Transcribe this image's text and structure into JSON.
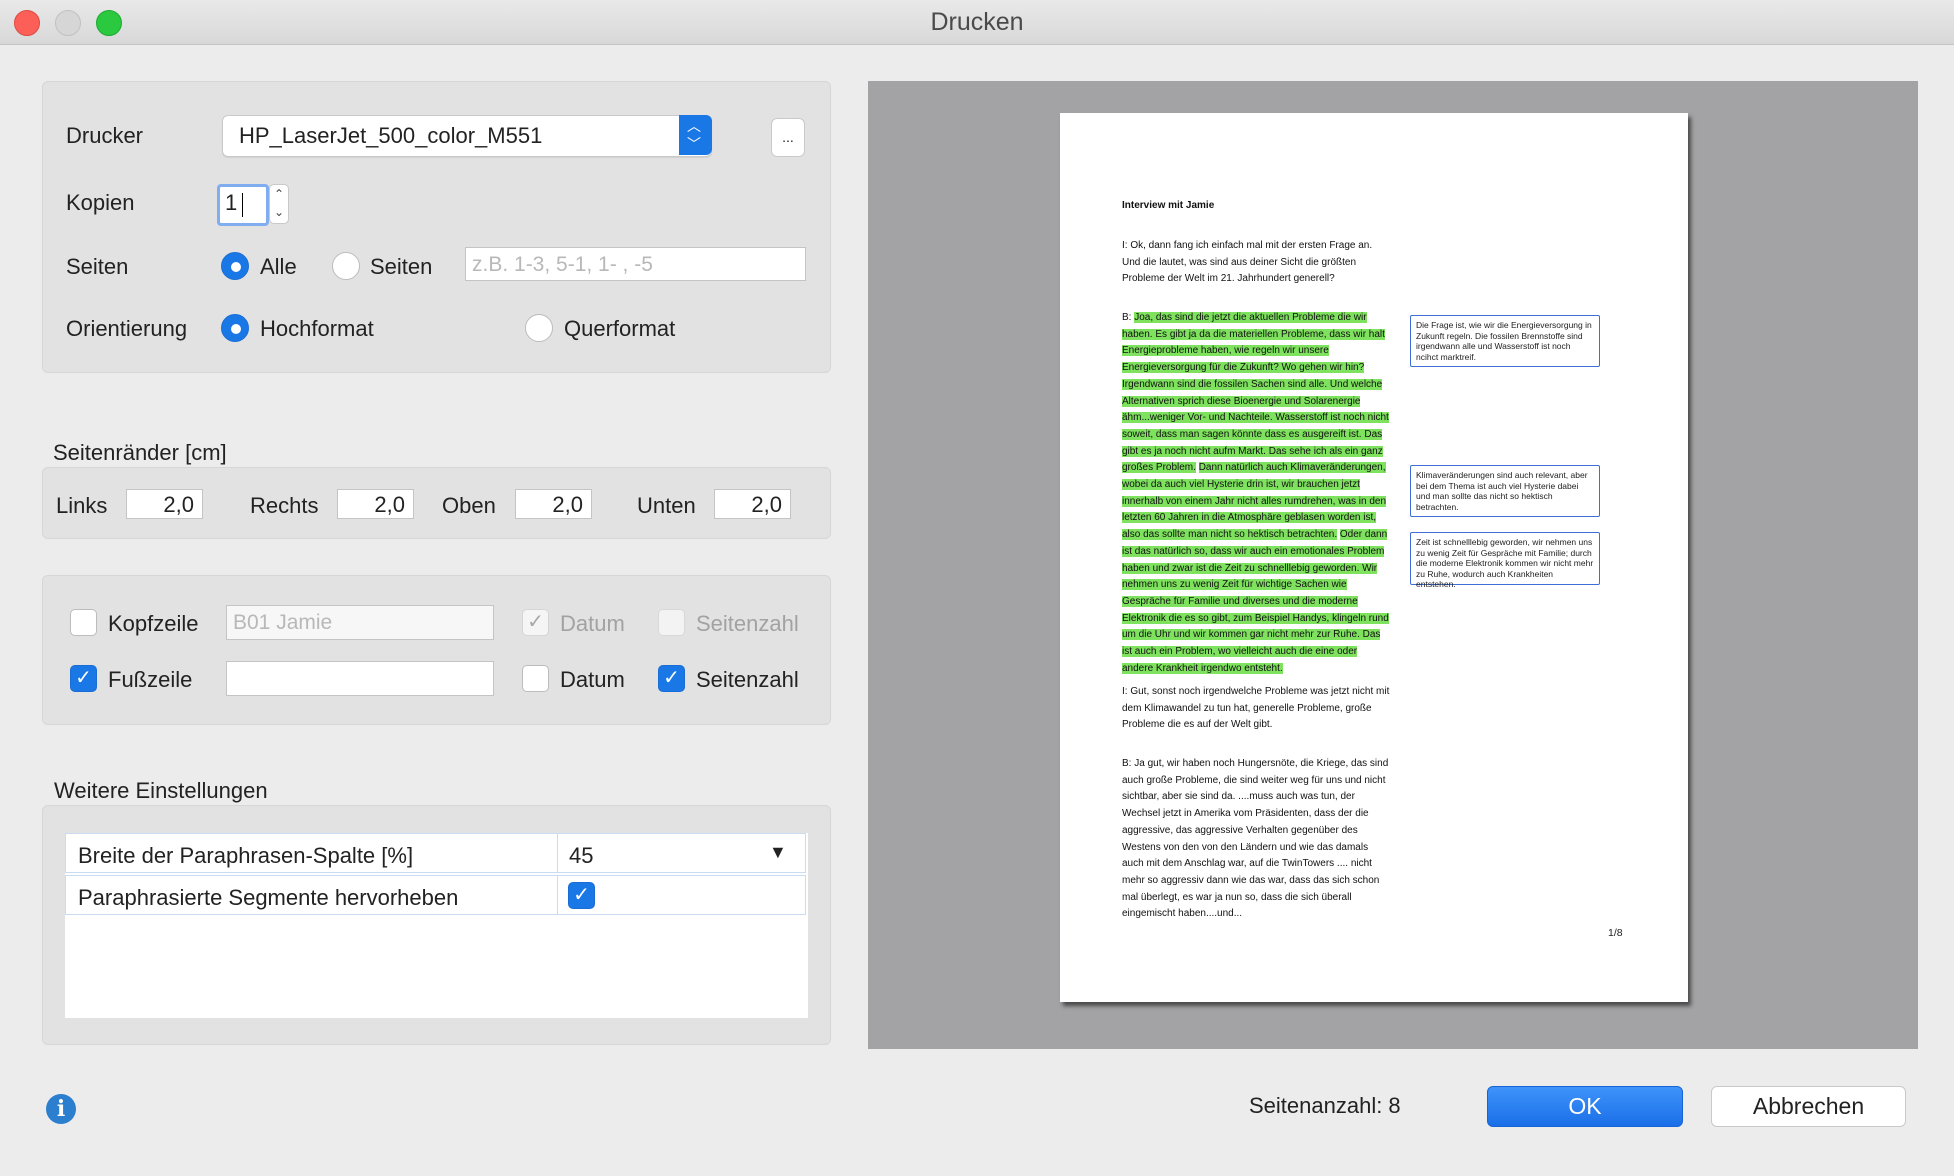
{
  "window": {
    "title": "Drucken"
  },
  "printer": {
    "label": "Drucker",
    "selected": "HP_LaserJet_500_color_M551",
    "more_label": "..."
  },
  "copies": {
    "label": "Kopien",
    "value": "1"
  },
  "pages": {
    "label": "Seiten",
    "option_all": "Alle",
    "option_pages": "Seiten",
    "placeholder": "z.B. 1-3, 5-1, 1- , -5",
    "selected": "Alle"
  },
  "orientation": {
    "label": "Orientierung",
    "portrait": "Hochformat",
    "landscape": "Querformat",
    "selected": "Hochformat"
  },
  "margins": {
    "heading": "Seitenränder [cm]",
    "left_label": "Links",
    "left": "2,0",
    "right_label": "Rechts",
    "right": "2,0",
    "top_label": "Oben",
    "top": "2,0",
    "bottom_label": "Unten",
    "bottom": "2,0"
  },
  "header_footer": {
    "header_label": "Kopfzeile",
    "header_checked": false,
    "header_text": "B01 Jamie",
    "header_date_label": "Datum",
    "header_date_checked": true,
    "header_pagenum_label": "Seitenzahl",
    "header_pagenum_checked": false,
    "footer_label": "Fußzeile",
    "footer_checked": true,
    "footer_text": "",
    "footer_date_label": "Datum",
    "footer_date_checked": false,
    "footer_pagenum_label": "Seitenzahl",
    "footer_pagenum_checked": true
  },
  "more_settings": {
    "heading": "Weitere Einstellungen",
    "rows": [
      {
        "name": "Breite der Paraphrasen-Spalte [%]",
        "value": "45"
      },
      {
        "name": "Paraphrasierte Segmente hervorheben",
        "checked": true
      }
    ]
  },
  "preview": {
    "doc_title": "Interview mit Jamie",
    "p1": "I: Ok, dann fang ich einfach mal mit der ersten Frage an. Und die lautet, was sind aus deiner Sicht die größten Probleme der Welt im 21. Jahrhundert generell?",
    "p2_prefix": "B: ",
    "p2_hl1": "Joa, das sind die jetzt die aktuellen Probleme die wir haben. Es gibt ja da die materiellen Probleme, dass wir halt Energieprobleme haben, wie regeln wir unsere Energieversorgung für die Zukunft? Wo gehen wir hin? Irgendwann sind die fossilen Sachen sind alle. Und welche Alternativen sprich diese Bioenergie und Solarenergie ähm...weniger Vor- und Nachteile. Wasserstoff ist noch nicht soweit, dass man sagen könnte dass es ausgereift ist. Das gibt es ja noch nicht aufm Markt. Das sehe ich als ein ganz großes Problem.",
    "p2_hl2": "Dann natürlich auch Klimaveränderungen, wobei da auch viel Hysterie drin ist, wir brauchen jetzt innerhalb von einem Jahr nicht alles rumdrehen, was in den letzten 60 Jahren in die Atmosphäre geblasen worden ist, also das sollte man nicht so hektisch betrachten.",
    "p2_hl3": "Oder dann ist das natürlich so, dass wir auch ein emotionales Problem haben und zwar ist die Zeit zu schnelllebig geworden. Wir nehmen uns zu wenig Zeit für wichtige Sachen wie Gespräche für Familie und diverses und die moderne Elektronik die es so gibt, zum Beispiel Handys, klingeln rund um die Uhr und wir kommen gar nicht mehr zur Ruhe. Das ist auch ein Problem, wo vielleicht auch die eine oder andere Krankheit irgendwo entsteht.",
    "p3": "I: Gut, sonst noch irgendwelche Probleme was jetzt nicht mit dem Klimawandel zu tun hat, generelle Probleme, große Probleme die es auf der Welt gibt.",
    "p4": "B: Ja gut, wir haben noch Hungersnöte, die Kriege, das sind auch große Probleme, die sind weiter weg für uns und nicht sichtbar, aber sie sind da. ....muss auch was tun, der Wechsel jetzt in Amerika vom Präsidenten, dass der die aggressive, das aggressive Verhalten gegenüber des Westens von den von den Ländern und wie das damals auch mit dem Anschlag war, auf die TwinTowers .... nicht mehr so aggressiv dann wie das war, dass das sich schon mal überlegt, es war ja nun so, dass die sich überall eingemischt haben....und...",
    "note1": "Die Frage ist, wie wir die Energieversorgung in Zukunft regeln. Die fossilen Brennstoffe sind irgendwann alle und Wasserstoff ist noch ncihct marktreif.",
    "note2": "Klimaveränderungen sind auch relevant, aber bei dem Thema ist auch viel Hysterie dabei und man sollte das nicht so hektisch betrachten.",
    "note3": "Zeit ist schnelllebig geworden, wir nehmen uns zu wenig Zeit für Gespräche mit Familie; durch die moderne Elektronik kommen wir nicht mehr zu Ruhe, wodurch auch Krankheiten entstehen.",
    "page_number": "1/8"
  },
  "footer": {
    "page_count": "Seitenanzahl: 8",
    "ok_label": "OK",
    "cancel_label": "Abbrechen"
  },
  "icons": {
    "info": "info-icon",
    "check": "✓",
    "dropdown": "▼"
  },
  "colors": {
    "accent": "#1a78e6",
    "highlight": "#7ee25e"
  }
}
